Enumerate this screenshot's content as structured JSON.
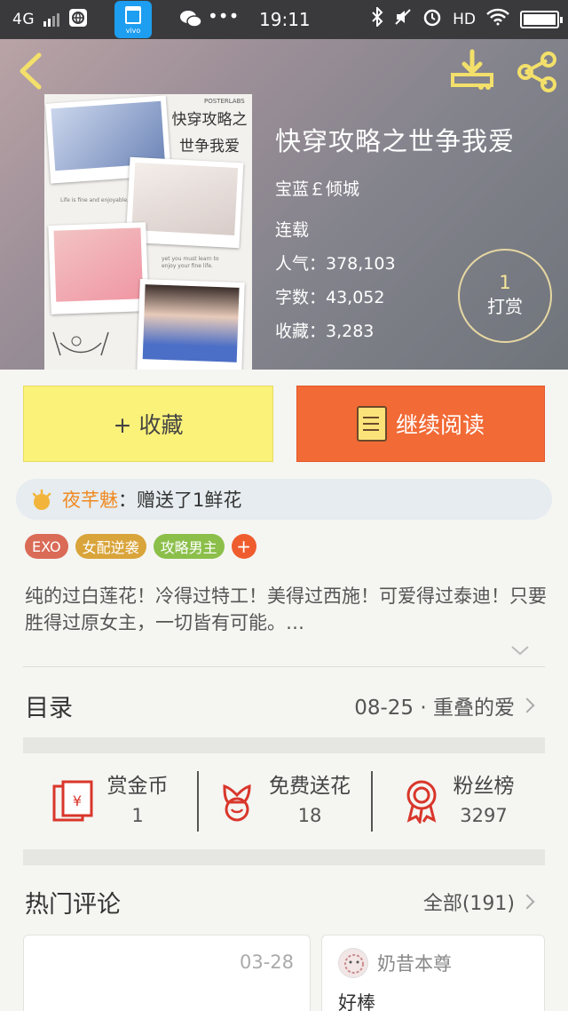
{
  "status_bar": {
    "network": "4G",
    "app_icon_label": "vivo",
    "time": "19:11",
    "hd": "HD"
  },
  "book": {
    "title": "快穿攻略之世争我爱",
    "author": "宝蓝￡倾城",
    "status": "连载",
    "popularity": "人气：378,103",
    "word_count": "字数：43,052",
    "favorites": "收藏：3,283",
    "tip_count": "1",
    "tip_label": "打赏",
    "cover": {
      "brand": "POSTERLABS",
      "title_line1": "快穿攻略之",
      "title_line2": "世争我爱",
      "note1": "Life is fine and enjoyable.",
      "note2": "yet you must learn to enjoy your fine life."
    }
  },
  "actions": {
    "collect_label": "+ 收藏",
    "read_label": "继续阅读"
  },
  "gift_notice": {
    "user": "夜芊魅",
    "message": "：赠送了1鲜花"
  },
  "tags": [
    {
      "label": "EXO",
      "color": "#d96b57"
    },
    {
      "label": "女配逆袭",
      "color": "#d9a43a"
    },
    {
      "label": "攻略男主",
      "color": "#8bbf4a"
    }
  ],
  "tag_add": "+",
  "description": "纯的过白莲花！冷得过特工！美得过西施！可爱得过泰迪！只要胜得过原女主，一切皆有可能。…",
  "toc": {
    "label": "目录",
    "latest": "08-25 · 重叠的爱"
  },
  "stats": [
    {
      "label": "赏金币",
      "value": "1",
      "icon": "red-envelope-icon"
    },
    {
      "label": "免费送花",
      "value": "18",
      "icon": "flower-icon"
    },
    {
      "label": "粉丝榜",
      "value": "3297",
      "icon": "medal-icon"
    }
  ],
  "comments": {
    "label": "热门评论",
    "all": "全部(191)",
    "items": [
      {
        "date": "03-28",
        "user": "",
        "text": ""
      },
      {
        "user": "奶昔本尊",
        "text": "好棒"
      }
    ]
  },
  "colors": {
    "collect_bg": "#fbf27a",
    "read_bg": "#f26a36",
    "accent_orange": "#f08a23",
    "icon_red": "#d9362b"
  }
}
